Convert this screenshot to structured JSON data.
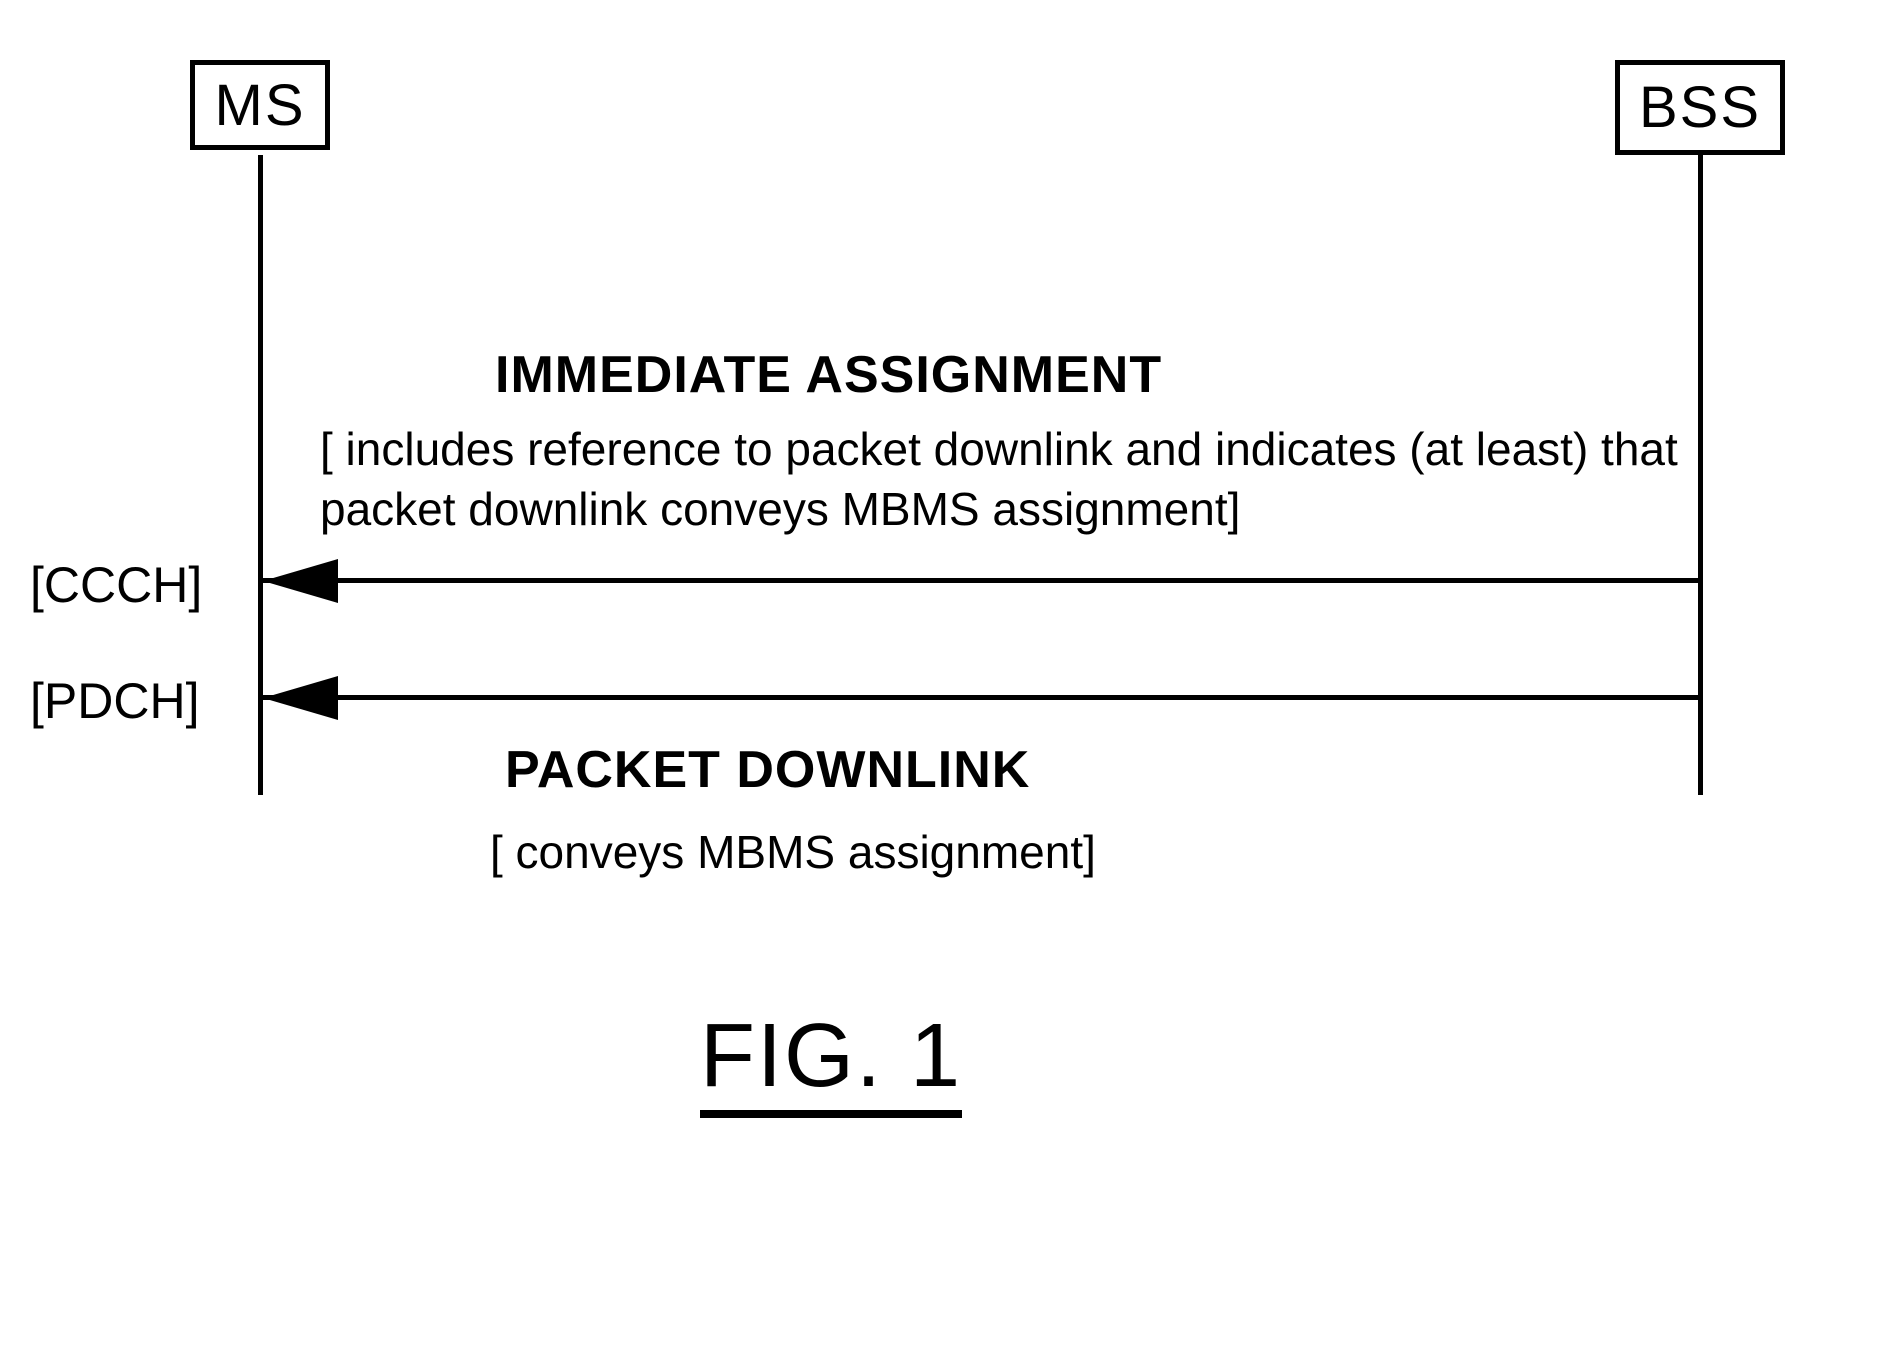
{
  "entities": {
    "ms": "MS",
    "bss": "BSS"
  },
  "messages": {
    "immediate_assignment": {
      "title": "IMMEDIATE ASSIGNMENT",
      "description": "[ includes reference to packet downlink and indicates (at least) that packet downlink conveys MBMS assignment]"
    },
    "packet_downlink": {
      "title": "PACKET DOWNLINK",
      "description": "[ conveys MBMS assignment]"
    }
  },
  "channels": {
    "ccch": "[CCCH]",
    "pdch": "[PDCH]"
  },
  "figure_label": "FIG. 1"
}
